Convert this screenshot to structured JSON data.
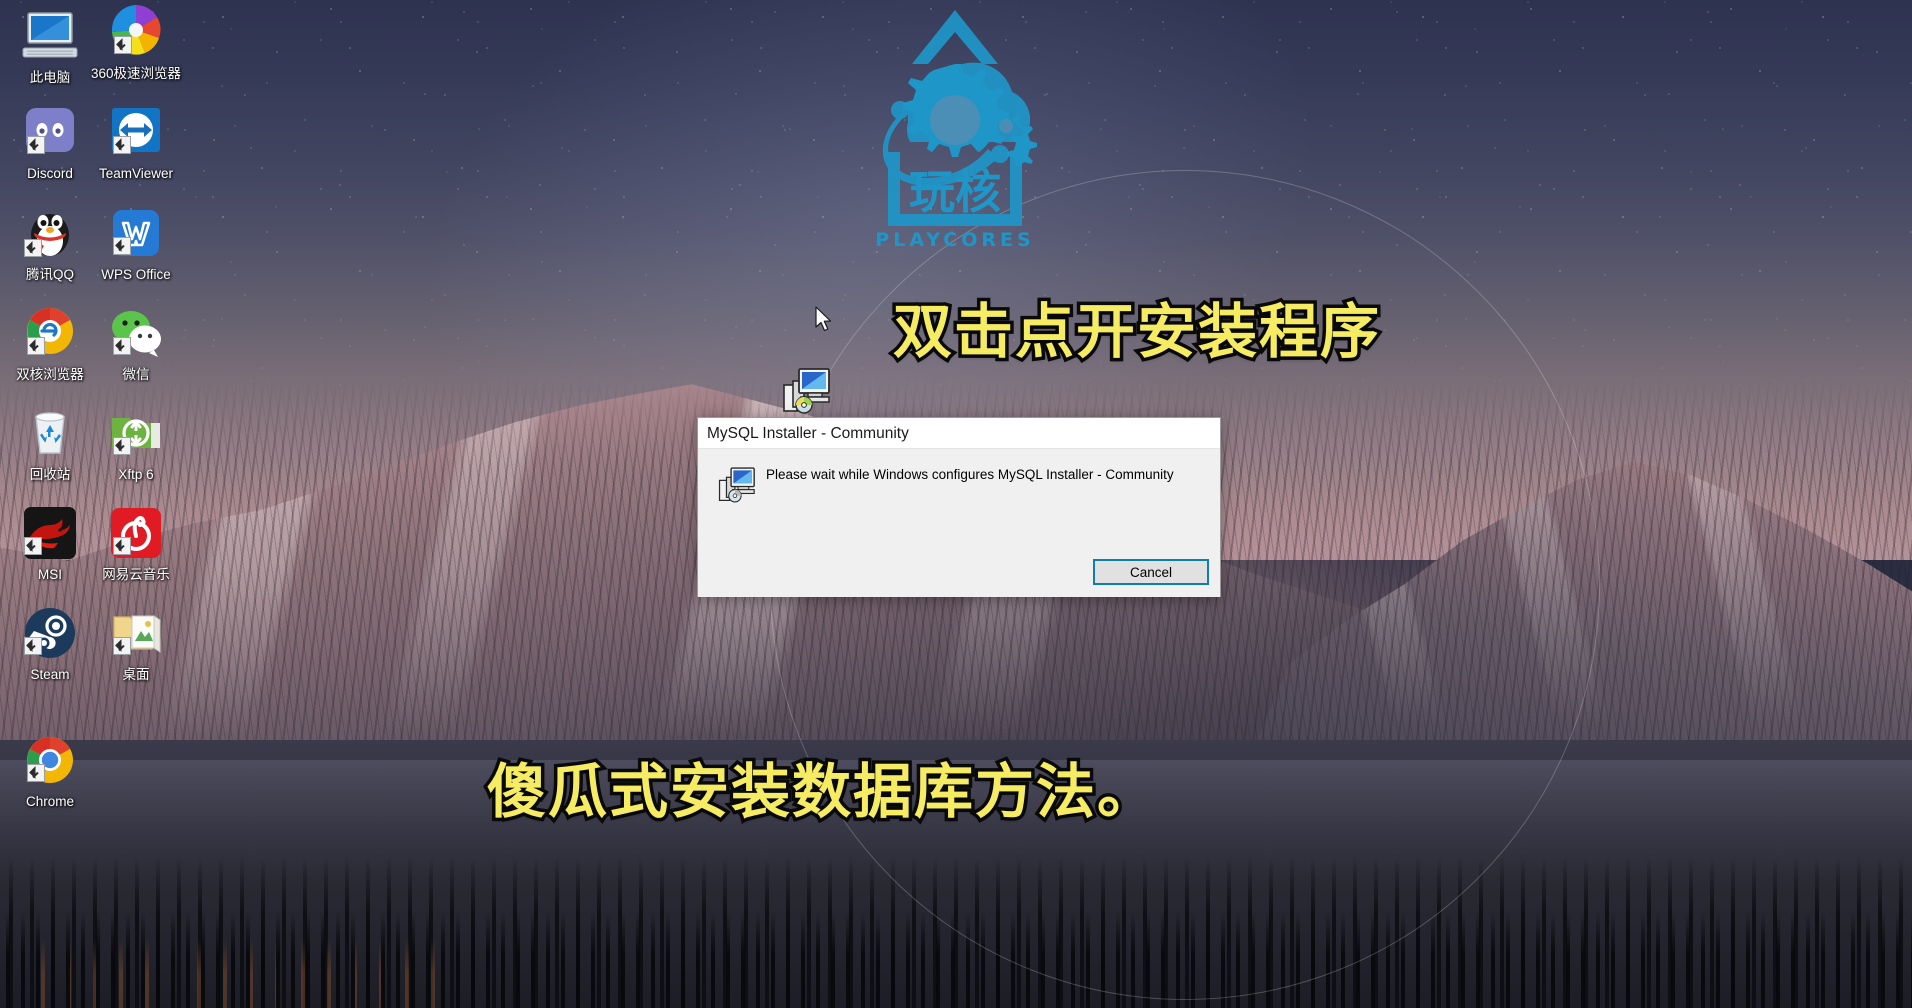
{
  "desktop": {
    "icons": [
      {
        "label": "此电脑",
        "icon": "this-pc-icon",
        "shortcut": false
      },
      {
        "label": "360极速浏览器",
        "icon": "360-browser-icon",
        "shortcut": true
      },
      {
        "label": "Discord",
        "icon": "discord-icon",
        "shortcut": true
      },
      {
        "label": "TeamViewer",
        "icon": "teamviewer-icon",
        "shortcut": true
      },
      {
        "label": "腾讯QQ",
        "icon": "tencent-qq-icon",
        "shortcut": true
      },
      {
        "label": "WPS Office",
        "icon": "wps-office-icon",
        "shortcut": true
      },
      {
        "label": "双核浏览器",
        "icon": "dual-core-browser-icon",
        "shortcut": true
      },
      {
        "label": "微信",
        "icon": "wechat-icon",
        "shortcut": true
      },
      {
        "label": "回收站",
        "icon": "recycle-bin-icon",
        "shortcut": false
      },
      {
        "label": "Xftp 6",
        "icon": "xftp-icon",
        "shortcut": true
      },
      {
        "label": "MSI",
        "icon": "msi-dragon-icon",
        "shortcut": true
      },
      {
        "label": "网易云音乐",
        "icon": "netease-cloud-music-icon",
        "shortcut": true
      },
      {
        "label": "Steam",
        "icon": "steam-icon",
        "shortcut": true
      },
      {
        "label": "桌面",
        "icon": "desktop-folder-icon",
        "shortcut": true
      },
      {
        "label": "Chrome",
        "icon": "chrome-icon",
        "shortcut": true
      }
    ],
    "loose_icon": {
      "label": "",
      "icon": "mysql-installer-setup-icon"
    }
  },
  "watermark": {
    "brand_cn": "玩核",
    "brand_en": "PLAYCORES",
    "color": "#1f96c8"
  },
  "captions": [
    {
      "text": "双击点开安装程序",
      "color": "#f5ec63",
      "outline": "#0b0b0b"
    },
    {
      "text": "傻瓜式安装数据库方法。",
      "color": "#f5ec63",
      "outline": "#0b0b0b"
    }
  ],
  "dialog": {
    "title": "MySQL Installer - Community",
    "message": "Please wait while Windows configures MySQL Installer - Community",
    "cancel_label": "Cancel",
    "icon": "installer-setup-icon",
    "titlebar_color": "#ffffff",
    "body_color": "#f0f0f0",
    "focus_color": "#0e7eb0"
  }
}
